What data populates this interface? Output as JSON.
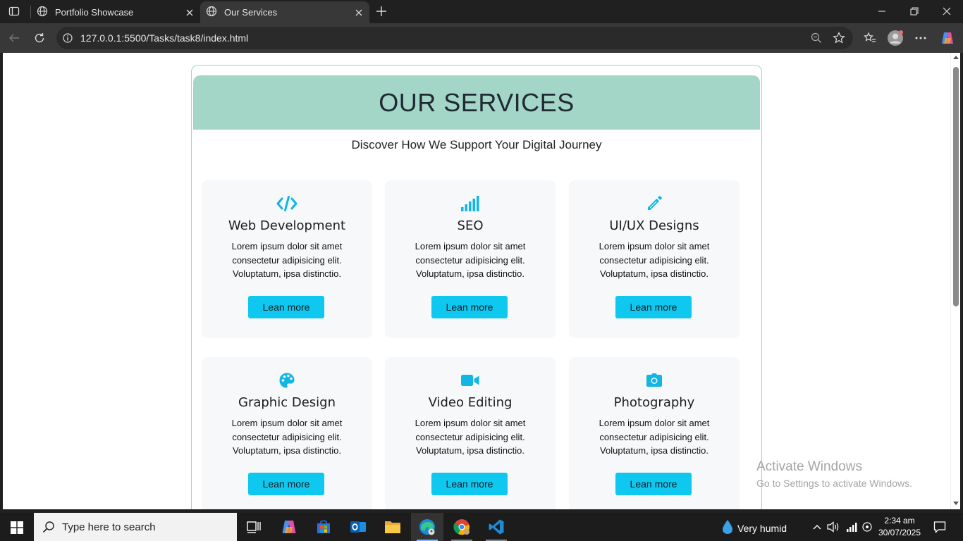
{
  "browser": {
    "tabs": [
      {
        "title": "Portfolio Showcase",
        "active": false
      },
      {
        "title": "Our Services",
        "active": true
      }
    ],
    "url": "127.0.0.1:5500/Tasks/task8/index.html"
  },
  "page": {
    "heading": "OUR SERVICES",
    "subtitle": "Discover How We Support Your Digital Journey",
    "cards": [
      {
        "icon": "code-icon",
        "title": "Web Development",
        "text": "Lorem ipsum dolor sit amet consectetur adipisicing elit. Voluptatum, ipsa distinctio.",
        "button": "Lean more"
      },
      {
        "icon": "signal-bars-icon",
        "title": "SEO",
        "text": "Lorem ipsum dolor sit amet consectetur adipisicing elit. Voluptatum, ipsa distinctio.",
        "button": "Lean more"
      },
      {
        "icon": "pencil-icon",
        "title": "UI/UX Designs",
        "text": "Lorem ipsum dolor sit amet consectetur adipisicing elit. Voluptatum, ipsa distinctio.",
        "button": "Lean more"
      },
      {
        "icon": "palette-icon",
        "title": "Graphic Design",
        "text": "Lorem ipsum dolor sit amet consectetur adipisicing elit. Voluptatum, ipsa distinctio.",
        "button": "Lean more"
      },
      {
        "icon": "video-camera-icon",
        "title": "Video Editing",
        "text": "Lorem ipsum dolor sit amet consectetur adipisicing elit. Voluptatum, ipsa distinctio.",
        "button": "Lean more"
      },
      {
        "icon": "camera-icon",
        "title": "Photography",
        "text": "Lorem ipsum dolor sit amet consectetur adipisicing elit. Voluptatum, ipsa distinctio.",
        "button": "Lean more"
      }
    ]
  },
  "watermark": {
    "line1": "Activate Windows",
    "line2": "Go to Settings to activate Windows."
  },
  "taskbar": {
    "search_placeholder": "Type here to search",
    "weather": "Very humid",
    "time": "2:34 am",
    "date": "30/07/2025"
  },
  "colors": {
    "banner": "#a3d6c6",
    "button": "#0fc8ef",
    "icon_accent": "#12b5e3",
    "card_bg": "#f6f8fa"
  }
}
